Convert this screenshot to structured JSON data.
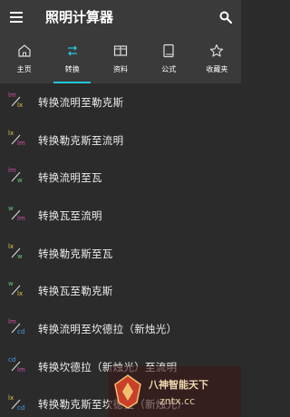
{
  "appbar": {
    "title": "照明计算器",
    "menu_icon": "menu-icon",
    "search_icon": "search-icon"
  },
  "tabs": [
    {
      "label": "主页",
      "icon": "home-icon",
      "active": false
    },
    {
      "label": "转换",
      "icon": "swap-icon",
      "active": true
    },
    {
      "label": "资料",
      "icon": "book-open-icon",
      "active": false
    },
    {
      "label": "公式",
      "icon": "book-icon",
      "active": false
    },
    {
      "label": "收藏夹",
      "icon": "star-icon",
      "active": false
    }
  ],
  "items": [
    {
      "top": "lm",
      "bottom": "lx",
      "top_color": "#d24fb0",
      "bottom_color": "#e6c84a",
      "label": "转换流明至勒克斯"
    },
    {
      "top": "lx",
      "bottom": "lm",
      "top_color": "#e6c84a",
      "bottom_color": "#d24fb0",
      "label": "转换勒克斯至流明"
    },
    {
      "top": "lm",
      "bottom": "w",
      "top_color": "#d24fb0",
      "bottom_color": "#5fc878",
      "label": "转换流明至瓦"
    },
    {
      "top": "w",
      "bottom": "lm",
      "top_color": "#5fc878",
      "bottom_color": "#d24fb0",
      "label": "转换瓦至流明"
    },
    {
      "top": "lx",
      "bottom": "w",
      "top_color": "#e6c84a",
      "bottom_color": "#5fc878",
      "label": "转换勒克斯至瓦"
    },
    {
      "top": "w",
      "bottom": "lx",
      "top_color": "#5fc878",
      "bottom_color": "#e6c84a",
      "label": "转换瓦至勒克斯"
    },
    {
      "top": "lm",
      "bottom": "cd",
      "top_color": "#d24fb0",
      "bottom_color": "#4a9ee6",
      "label": "转换流明至坎德拉（新烛光）"
    },
    {
      "top": "cd",
      "bottom": "lm",
      "top_color": "#4a9ee6",
      "bottom_color": "#d24fb0",
      "label": "转换坎德拉（新烛光）至流明"
    },
    {
      "top": "lx",
      "bottom": "cd",
      "top_color": "#e6c84a",
      "bottom_color": "#4a9ee6",
      "label": "转换勒克斯至坎德拉（新烛光）"
    }
  ],
  "watermark": {
    "line1": "八神智能天下",
    "line2": "zntx.cc"
  }
}
